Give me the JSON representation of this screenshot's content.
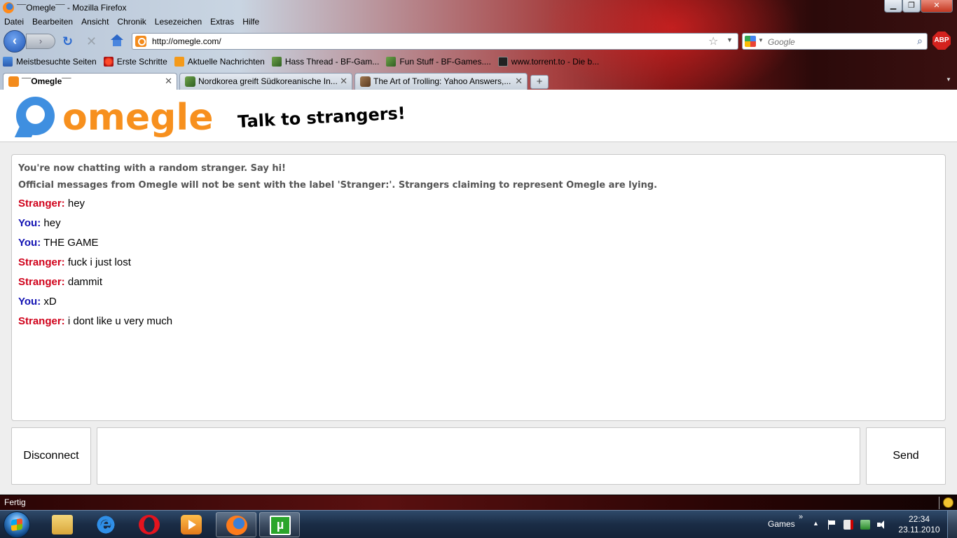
{
  "window": {
    "title": "¯¯Omegle¯¯ - Mozilla Firefox",
    "minimize": "▁",
    "maximize": "❐",
    "close": "✕"
  },
  "menu": [
    "Datei",
    "Bearbeiten",
    "Ansicht",
    "Chronik",
    "Lesezeichen",
    "Extras",
    "Hilfe"
  ],
  "navigation": {
    "back": "‹",
    "forward": "›",
    "reload": "↻",
    "stop": "✕",
    "url": "http://omegle.com/",
    "search_placeholder": "Google",
    "adblock_label": "ABP"
  },
  "bookmarks": [
    {
      "label": "Meistbesuchte Seiten",
      "icon": "frequent-icon"
    },
    {
      "label": "Erste Schritte",
      "icon": "firefox-start-icon"
    },
    {
      "label": "Aktuelle Nachrichten",
      "icon": "rss-icon"
    },
    {
      "label": "Hass Thread - BF-Gam...",
      "icon": "bf-games-icon"
    },
    {
      "label": "Fun Stuff - BF-Games....",
      "icon": "bf-games-icon"
    },
    {
      "label": "www.torrent.to - Die b...",
      "icon": "torrent-icon"
    }
  ],
  "tabs": [
    {
      "label": "¯¯Omegle¯¯",
      "active": true
    },
    {
      "label": "Nordkorea greift Südkoreanische In...",
      "active": false
    },
    {
      "label": "The Art of Trolling: Yahoo Answers,...",
      "active": false
    }
  ],
  "tab_new": "+",
  "page": {
    "logo_text": "omegle",
    "tagline": "Talk to strangers!",
    "system_messages": [
      "You're now chatting with a random stranger. Say hi!",
      "Official messages from Omegle will not be sent with the label 'Stranger:'. Strangers claiming to represent Omegle are lying."
    ],
    "messages": [
      {
        "sender": "Stranger:",
        "text": "hey"
      },
      {
        "sender": "You:",
        "text": "hey"
      },
      {
        "sender": "You:",
        "text": "THE GAME"
      },
      {
        "sender": "Stranger:",
        "text": "fuck i just lost"
      },
      {
        "sender": "Stranger:",
        "text": "dammit"
      },
      {
        "sender": "You:",
        "text": "xD"
      },
      {
        "sender": "Stranger:",
        "text": "i dont like u very much"
      }
    ],
    "disconnect_label": "Disconnect",
    "send_label": "Send",
    "input_value": ""
  },
  "status": {
    "text": "Fertig"
  },
  "taskbar": {
    "apps": [
      "windows-explorer",
      "internet-explorer",
      "opera",
      "media-player",
      "firefox",
      "utorrent"
    ],
    "tray_label": "Games",
    "tray_chevron": "»",
    "tray_up": "▲",
    "time": "22:34",
    "date": "23.11.2010"
  },
  "colors": {
    "stranger": "#d0021b",
    "you": "#1212b3",
    "omegle_orange": "#f7901e",
    "omegle_blue": "#3f8fe0"
  }
}
